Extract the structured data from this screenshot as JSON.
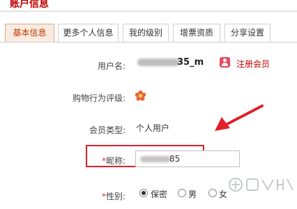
{
  "page": {
    "title": "账户信息"
  },
  "tabs": [
    {
      "label": "基本信息",
      "active": true
    },
    {
      "label": "更多个人信息",
      "active": false
    },
    {
      "label": "我的级别",
      "active": false
    },
    {
      "label": "增票资质",
      "active": false
    },
    {
      "label": "分享设置",
      "active": false
    }
  ],
  "fields": {
    "username": {
      "label": "用户名:",
      "value_suffix": "35_m",
      "register_link": "注册会员"
    },
    "rating": {
      "label": "购物行为评级:"
    },
    "member_type": {
      "label": "会员类型:",
      "value": "个人用户"
    },
    "nickname": {
      "star": "*",
      "label": "昵称:",
      "value_suffix": "85"
    },
    "gender": {
      "star": "*",
      "label": "性别:",
      "options": [
        "保密",
        "男",
        "女"
      ],
      "selected": "保密"
    }
  },
  "colors": {
    "accent": "#c00000",
    "highlight_box": "#e0202a",
    "active_tab_bg": "#f9ebe1"
  },
  "icons": {
    "register": "user-badge-icon",
    "rating": "flower-icon",
    "annotation": "arrow-icon"
  }
}
